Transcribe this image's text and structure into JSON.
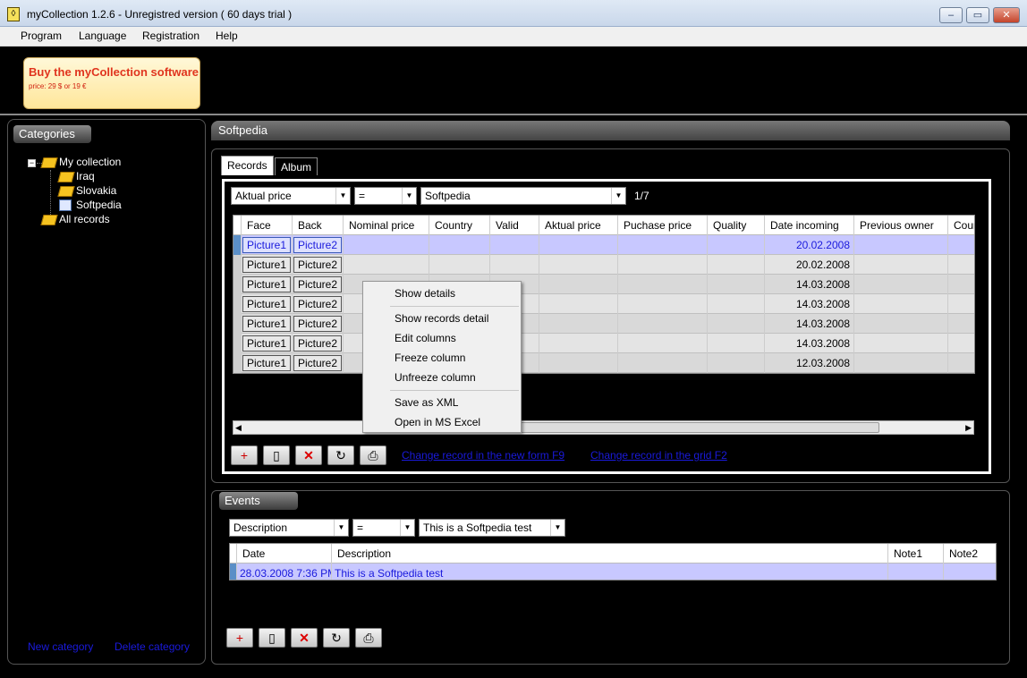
{
  "window": {
    "title": "myCollection 1.2.6 - Unregistred version ( 60 days trial )"
  },
  "menu": [
    "Program",
    "Language",
    "Registration",
    "Help"
  ],
  "banner": {
    "title": "Buy the myCollection software",
    "price": "price: 29 $ or 19 €"
  },
  "categories": {
    "header": "Categories",
    "tree": [
      {
        "label": "My collection",
        "expander": "−"
      },
      {
        "label": "Iraq"
      },
      {
        "label": "Slovakia"
      },
      {
        "label": "Softpedia"
      },
      {
        "label": "All records"
      }
    ],
    "new_label": "New category",
    "delete_label": "Delete category"
  },
  "main": {
    "header": "Softpedia",
    "tabs": [
      "Records",
      "Album"
    ],
    "filter": {
      "field": "Aktual price",
      "op": "=",
      "value": "Softpedia",
      "counter": "1/7"
    },
    "columns": [
      "Face",
      "Back",
      "Nominal price",
      "Country",
      "Valid",
      "Aktual price",
      "Puchase price",
      "Quality",
      "Date incoming",
      "Previous owner",
      "Coun"
    ],
    "rows": [
      {
        "face": "Picture1",
        "back": "Picture2",
        "date": "20.02.2008"
      },
      {
        "face": "Picture1",
        "back": "Picture2",
        "date": "20.02.2008"
      },
      {
        "face": "Picture1",
        "back": "Picture2",
        "date": "14.03.2008"
      },
      {
        "face": "Picture1",
        "back": "Picture2",
        "date": "14.03.2008"
      },
      {
        "face": "Picture1",
        "back": "Picture2",
        "date": "14.03.2008"
      },
      {
        "face": "Picture1",
        "back": "Picture2",
        "date": "14.03.2008"
      },
      {
        "face": "Picture1",
        "back": "Picture2",
        "date": "12.03.2008"
      }
    ],
    "links": {
      "new_form": "Change record in the new form F9",
      "grid": "Change record in the grid F2"
    }
  },
  "context_menu": [
    "Show details",
    "Show records detail",
    "Edit columns",
    "Freeze column",
    "Unfreeze column",
    "Save as XML",
    "Open in MS Excel"
  ],
  "events": {
    "header": "Events",
    "filter": {
      "field": "Description",
      "op": "=",
      "value": "This is a Softpedia test"
    },
    "columns": [
      "Date",
      "Description",
      "Note1",
      "Note2"
    ],
    "rows": [
      {
        "date": "28.03.2008 7:36 PM",
        "description": "This is a Softpedia test"
      }
    ]
  },
  "colors": {
    "selected_row": "#c8c8ff",
    "link": "#1a1adc",
    "banner_text": "#e0341e"
  }
}
